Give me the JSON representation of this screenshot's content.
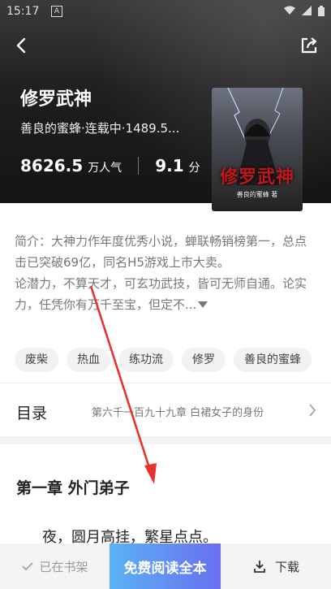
{
  "status_bar": {
    "time": "15:17",
    "indicator": "A"
  },
  "book": {
    "title": "修罗武神",
    "meta": "善良的蜜蜂·连载中·1489.5...",
    "popularity": "8626.5",
    "popularity_unit": "万人气",
    "score": "9.1",
    "score_unit": "分",
    "cover_title": "修罗武神",
    "cover_author": "善良的蜜蜂 著"
  },
  "intro": {
    "line1": "简介：大神力作年度优秀小说，蝉联畅销榜第一，总点击已突破69亿，同名H5游戏上市大卖。",
    "line2": "论潜力，不算天才，可玄功武技，皆可无师自通。论实力，任凭你有万千至宝，但定不..."
  },
  "tags": [
    "废柴",
    "热血",
    "练功流",
    "修罗",
    "善良的蜜蜂"
  ],
  "toc": {
    "label": "目录",
    "latest": "第六千一百九十九章 白裙女子的身份"
  },
  "chapter": {
    "title": "第一章 外门弟子",
    "first_line": "夜，圆月高挂，繁星点点。"
  },
  "bottom_bar": {
    "shelf": "已在书架",
    "read": "免费阅读全本",
    "download": "下载"
  },
  "colors": {
    "accent_start": "#5ab2f5",
    "accent_end": "#6a6ff0",
    "annotation": "#e8322b"
  }
}
